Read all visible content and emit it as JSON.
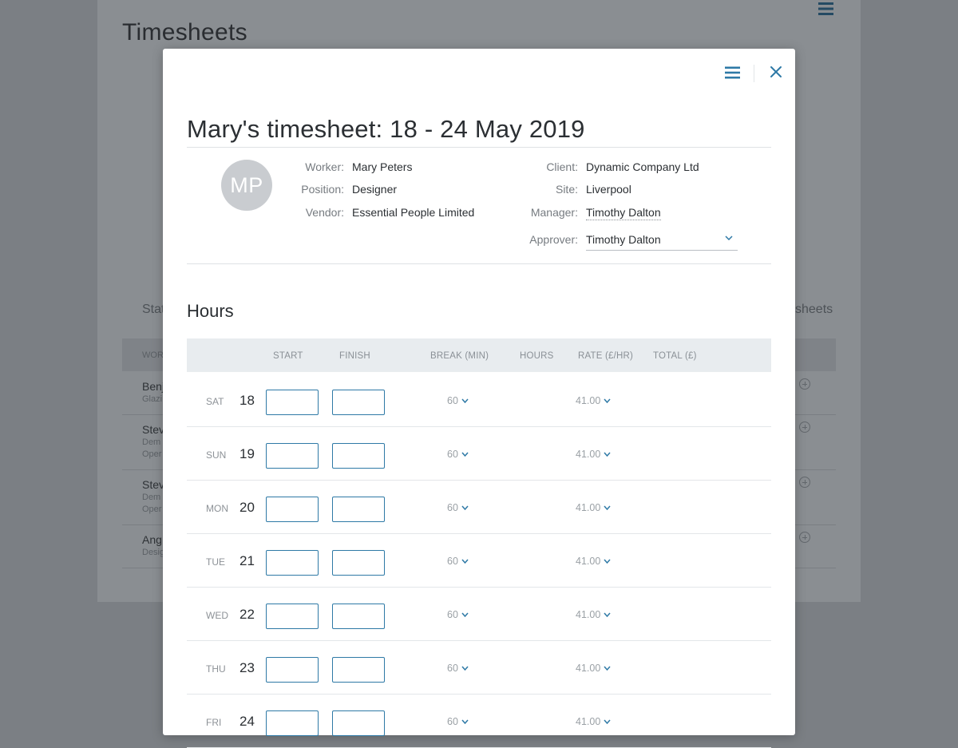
{
  "background": {
    "title": "Timesheets",
    "status_label": "Stat",
    "timesheets_label": "sheets",
    "table_header": "WOR",
    "rows": [
      {
        "name": "Benj",
        "sub": [
          "Glazi"
        ]
      },
      {
        "name": "Stev",
        "sub": [
          "Dem",
          "Oper"
        ]
      },
      {
        "name": "Stev",
        "sub": [
          "Dem",
          "Oper"
        ]
      },
      {
        "name": "Ang",
        "sub": [
          "Desig"
        ]
      }
    ]
  },
  "modal": {
    "title": "Mary's timesheet: 18 - 24 May 2019",
    "avatar_initials": "MP",
    "worker_label": "Worker:",
    "worker": "Mary Peters",
    "position_label": "Position:",
    "position": "Designer",
    "vendor_label": "Vendor:",
    "vendor": "Essential People Limited",
    "client_label": "Client:",
    "client": "Dynamic Company Ltd",
    "site_label": "Site:",
    "site": "Liverpool",
    "manager_label": "Manager:",
    "manager": "Timothy Dalton",
    "approver_label": "Approver:",
    "approver": "Timothy Dalton",
    "hours_title": "Hours",
    "columns": {
      "start": "START",
      "finish": "FINISH",
      "break": "BREAK (MIN)",
      "hours": "HOURS",
      "rate": "RATE (£/HR)",
      "total": "TOTAL (£)"
    },
    "days": [
      {
        "day": "SAT",
        "date": "18",
        "break": "60",
        "rate": "41.00"
      },
      {
        "day": "SUN",
        "date": "19",
        "break": "60",
        "rate": "41.00"
      },
      {
        "day": "MON",
        "date": "20",
        "break": "60",
        "rate": "41.00"
      },
      {
        "day": "TUE",
        "date": "21",
        "break": "60",
        "rate": "41.00"
      },
      {
        "day": "WED",
        "date": "22",
        "break": "60",
        "rate": "41.00"
      },
      {
        "day": "THU",
        "date": "23",
        "break": "60",
        "rate": "41.00"
      },
      {
        "day": "FRI",
        "date": "24",
        "break": "60",
        "rate": "41.00"
      }
    ]
  },
  "colors": {
    "accent": "#2e79a6",
    "overlay": "#7b7f84",
    "table_header_bg": "#e8ecef"
  }
}
